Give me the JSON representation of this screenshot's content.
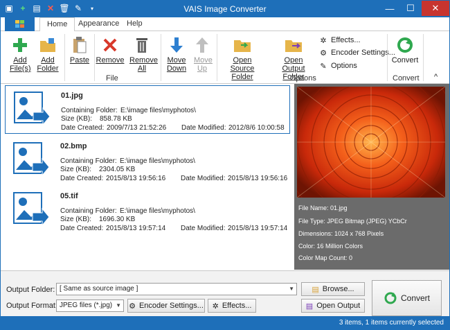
{
  "window": {
    "title": "VAIS Image Converter",
    "minimize": "—",
    "maximize": "☐",
    "close": "✕"
  },
  "quick_access": {
    "icons": [
      "image-icon",
      "add-icon",
      "folder-add-icon",
      "remove-icon",
      "delete-icon",
      "wrench-icon",
      "customize-icon"
    ]
  },
  "tabs": [
    {
      "label": "Home"
    },
    {
      "label": "Appearance"
    },
    {
      "label": "Help"
    }
  ],
  "ribbon": {
    "add_files": "Add File(s)",
    "add_folder": "Add Folder",
    "paste": "Paste",
    "remove": "Remove",
    "remove_all": "Remove All",
    "move_down": "Move Down",
    "move_up": "Move Up",
    "group_file": "File",
    "open_source": "Open Source Folder",
    "open_output": "Open Output Folder",
    "effects": "Effects...",
    "encoder_settings": "Encoder Settings...",
    "options": "Options",
    "group_options": "Options",
    "convert": "Convert",
    "group_convert": "Convert",
    "collapse": "^"
  },
  "files": [
    {
      "name": "01.jpg",
      "folder_label": "Containing Folder:",
      "folder": "E:\\image files\\myphotos\\",
      "size_label": "Size (KB):",
      "size": "858.78 KB",
      "created_label": "Date Created:",
      "created": "2009/7/13 21:52:26",
      "modified_label": "Date Modified:",
      "modified": "2012/8/6 10:00:58"
    },
    {
      "name": "02.bmp",
      "folder_label": "Containing Folder:",
      "folder": "E:\\image files\\myphotos\\",
      "size_label": "Size (KB):",
      "size": "2304.05 KB",
      "created_label": "Date Created:",
      "created": "2015/8/13 19:56:16",
      "modified_label": "Date Modified:",
      "modified": "2015/8/13 19:56:16"
    },
    {
      "name": "05.tif",
      "folder_label": "Containing Folder:",
      "folder": "E:\\image files\\myphotos\\",
      "size_label": "Size (KB):",
      "size": "1696.30 KB",
      "created_label": "Date Created:",
      "created": "2015/8/13 19:57:14",
      "modified_label": "Date Modified:",
      "modified": "2015/8/13 19:57:14"
    }
  ],
  "preview": {
    "file_name": "File Name: 01.jpg",
    "file_type": "File Type: JPEG Bitmap (JPEG) YCbCr",
    "dimensions": "Dimensions: 1024 x 768 Pixels",
    "color": "Color: 16 Million Colors",
    "color_map": "Color Map Count: 0"
  },
  "output": {
    "folder_label": "Output Folder:",
    "folder_value": "[ Same as source image ]",
    "format_label": "Output Format:",
    "format_value": "JPEG files (*.jpg)",
    "browse": "Browse...",
    "encoder_settings": "Encoder Settings...",
    "effects": "Effects...",
    "open_output": "Open Output",
    "convert": "Convert"
  },
  "status": {
    "text": "3 items, 1 items currently selected"
  },
  "colors": {
    "accent": "#1e6fb9",
    "close": "#c7342f",
    "preview_bg": "#6b6b6b"
  }
}
